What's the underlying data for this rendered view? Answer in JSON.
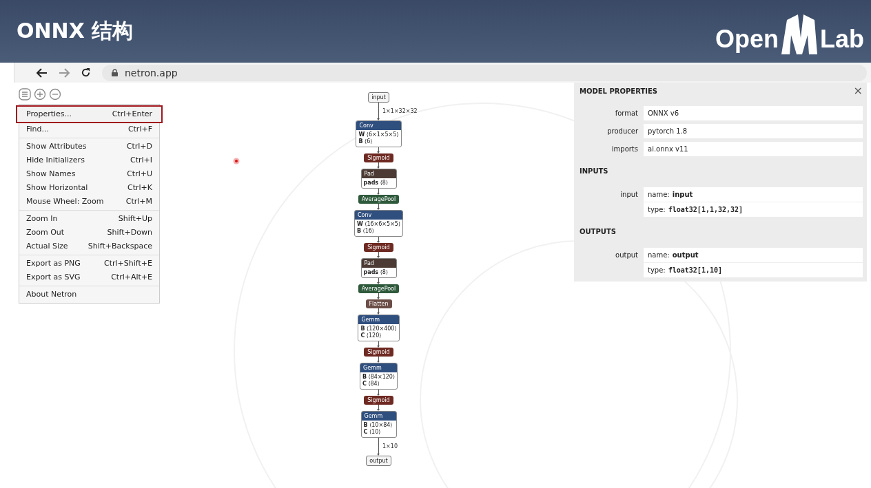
{
  "slide": {
    "title": "ONNX 结构",
    "logo": {
      "left": "Open",
      "right": "Lab"
    }
  },
  "browser": {
    "url": "netron.app"
  },
  "menu": {
    "groups": [
      [
        {
          "label": "Properties...",
          "shortcut": "Ctrl+Enter",
          "highlighted": true
        },
        {
          "label": "Find...",
          "shortcut": "Ctrl+F",
          "highlighted": false
        }
      ],
      [
        {
          "label": "Show Attributes",
          "shortcut": "Ctrl+D",
          "highlighted": false
        },
        {
          "label": "Hide Initializers",
          "shortcut": "Ctrl+I",
          "highlighted": false
        },
        {
          "label": "Show Names",
          "shortcut": "Ctrl+U",
          "highlighted": false
        },
        {
          "label": "Show Horizontal",
          "shortcut": "Ctrl+K",
          "highlighted": false
        },
        {
          "label": "Mouse Wheel: Zoom",
          "shortcut": "Ctrl+M",
          "highlighted": false
        }
      ],
      [
        {
          "label": "Zoom In",
          "shortcut": "Shift+Up",
          "highlighted": false
        },
        {
          "label": "Zoom Out",
          "shortcut": "Shift+Down",
          "highlighted": false
        },
        {
          "label": "Actual Size",
          "shortcut": "Shift+Backspace",
          "highlighted": false
        }
      ],
      [
        {
          "label": "Export as PNG",
          "shortcut": "Ctrl+Shift+E",
          "highlighted": false
        },
        {
          "label": "Export as SVG",
          "shortcut": "Ctrl+Alt+E",
          "highlighted": false
        }
      ],
      [
        {
          "label": "About Netron",
          "highlighted": false
        }
      ]
    ]
  },
  "graph": {
    "nodes": [
      {
        "kind": "io",
        "label": "input",
        "edge_label": "1×1×32×32"
      },
      {
        "kind": "op",
        "label": "Conv",
        "color": "#2f4f7f",
        "attrs": [
          "**W** ⟨6×1×5×5⟩",
          "**B** ⟨6⟩"
        ]
      },
      {
        "kind": "pill",
        "label": "Sigmoid",
        "color": "#6e2a22"
      },
      {
        "kind": "op",
        "label": "Pad",
        "color": "#4b3b34",
        "attrs": [
          "**pads** ⟨8⟩"
        ]
      },
      {
        "kind": "pill",
        "label": "AveragePool",
        "color": "#2e5a3b"
      },
      {
        "kind": "op",
        "label": "Conv",
        "color": "#2f4f7f",
        "attrs": [
          "**W** ⟨16×6×5×5⟩",
          "**B** ⟨16⟩"
        ]
      },
      {
        "kind": "pill",
        "label": "Sigmoid",
        "color": "#6e2a22"
      },
      {
        "kind": "op",
        "label": "Pad",
        "color": "#4b3b34",
        "attrs": [
          "**pads** ⟨8⟩"
        ]
      },
      {
        "kind": "pill",
        "label": "AveragePool",
        "color": "#2e5a3b"
      },
      {
        "kind": "pill",
        "label": "Flatten",
        "color": "#6b4e47"
      },
      {
        "kind": "op",
        "label": "Gemm",
        "color": "#2f4f7f",
        "attrs": [
          "**B** ⟨120×400⟩",
          "**C** ⟨120⟩"
        ]
      },
      {
        "kind": "pill",
        "label": "Sigmoid",
        "color": "#6e2a22"
      },
      {
        "kind": "op",
        "label": "Gemm",
        "color": "#2f4f7f",
        "attrs": [
          "**B** ⟨84×120⟩",
          "**C** ⟨84⟩"
        ]
      },
      {
        "kind": "pill",
        "label": "Sigmoid",
        "color": "#6e2a22"
      },
      {
        "kind": "op",
        "label": "Gemm",
        "color": "#2f4f7f",
        "attrs": [
          "**B** ⟨10×84⟩",
          "**C** ⟨10⟩"
        ],
        "edge_label": "1×10"
      },
      {
        "kind": "io",
        "label": "output"
      }
    ]
  },
  "properties": {
    "title": "MODEL PROPERTIES",
    "close": "×",
    "fields": [
      {
        "label": "format",
        "value": "ONNX v6"
      },
      {
        "label": "producer",
        "value": "pytorch 1.8"
      },
      {
        "label": "imports",
        "value": "ai.onnx v11"
      }
    ],
    "inputs_title": "INPUTS",
    "inputs": [
      {
        "label": "input",
        "name_label": "name:",
        "name": "input",
        "type_label": "type:",
        "type": "float32[1,1,32,32]"
      }
    ],
    "outputs_title": "OUTPUTS",
    "outputs": [
      {
        "label": "output",
        "name_label": "name:",
        "name": "output",
        "type_label": "type:",
        "type": "float32[1,10]"
      }
    ]
  }
}
